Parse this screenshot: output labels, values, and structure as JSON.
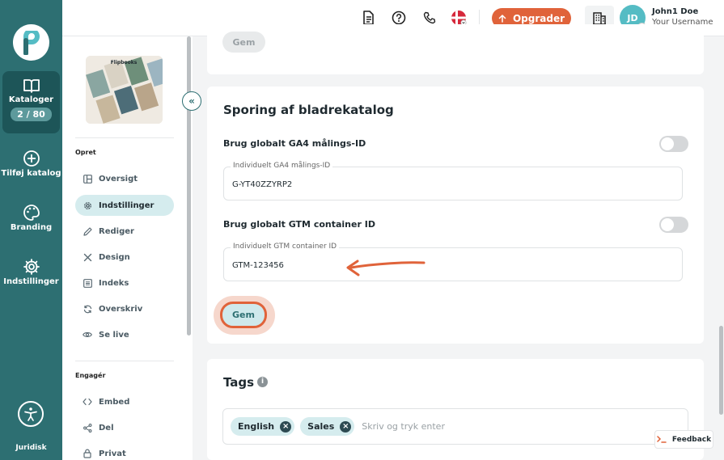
{
  "sidebar": {
    "items": [
      {
        "label": "Kataloger",
        "counter": "2 / 80",
        "icon": "book-open-icon"
      },
      {
        "label": "Tilføj katalog",
        "icon": "plus-circle-icon"
      },
      {
        "label": "Branding",
        "icon": "palette-icon"
      },
      {
        "label": "Indstillinger",
        "icon": "gear-icon"
      }
    ],
    "footer": "Juridisk"
  },
  "topbar": {
    "upgrade_label": "Opgrader",
    "user_initials": "JD",
    "user_name": "John1 Doe",
    "user_subtitle": "Your Username"
  },
  "subnav": {
    "thumb_title": "Flipbooks",
    "sections": [
      {
        "heading": "Opret",
        "items": [
          "Oversigt",
          "Indstillinger",
          "Rediger",
          "Design",
          "Indeks",
          "Overskriv",
          "Se live"
        ]
      },
      {
        "heading": "Engagér",
        "items": [
          "Embed",
          "Del",
          "Privat"
        ]
      }
    ],
    "active_item": "Indstillinger"
  },
  "main": {
    "prev_card_button": "Gem",
    "tracking": {
      "title": "Sporing af bladrekatalog",
      "ga4_toggle_label": "Brug globalt GA4 målings-ID",
      "ga4_field_label": "Individuelt GA4 målings-ID",
      "ga4_value": "G-YT40ZZYRP2",
      "gtm_toggle_label": "Brug globalt GTM container ID",
      "gtm_field_label": "Individuelt GTM container ID",
      "gtm_value": "GTM-123456",
      "save_label": "Gem"
    },
    "tags": {
      "title": "Tags",
      "items": [
        "English",
        "Sales"
      ],
      "placeholder": "Skriv og tryk enter"
    }
  },
  "feedback_label": "Feedback",
  "colors": {
    "sidebar": "#2d6f72",
    "accent": "#e0633a",
    "active_bg": "#d5ecee"
  }
}
